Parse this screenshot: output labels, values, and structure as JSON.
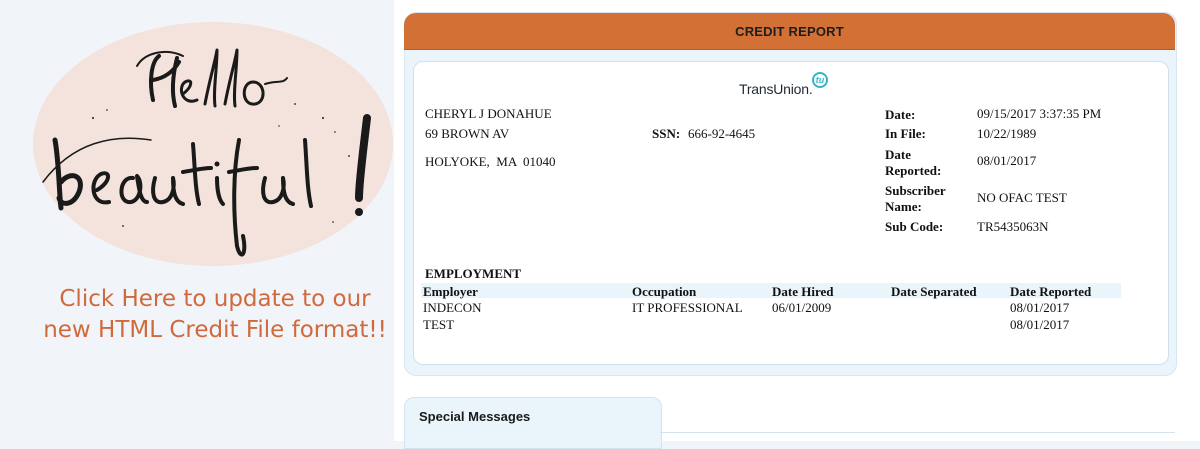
{
  "promo": {
    "link_text": "Click Here to update to our new HTML Credit File format!!"
  },
  "report": {
    "header_title": "CREDIT REPORT",
    "bureau": {
      "logo_text": "TransUnion.",
      "badge": "tu",
      "logo_color": "#33b5c9"
    },
    "consumer": {
      "name": "CHERYL J DONAHUE",
      "address_line1": "69 BROWN AV",
      "city_state_zip": "HOLYOKE,  MA  01040",
      "ssn_label": "SSN:",
      "ssn_value": "666-92-4645"
    },
    "meta": {
      "date_label": "Date:",
      "date_value": "09/15/2017 3:37:35 PM",
      "in_file_label": "In File:",
      "in_file_value": "10/22/1989",
      "date_reported_label_1": "Date",
      "date_reported_label_2": "Reported:",
      "date_reported_value": "08/01/2017",
      "subscriber_label_1": "Subscriber",
      "subscriber_label_2": "Name:",
      "subscriber_value": "NO OFAC TEST",
      "sub_code_label": "Sub Code:",
      "sub_code_value": "TR5435063N"
    },
    "employment": {
      "section_title": "EMPLOYMENT",
      "columns": [
        "Employer",
        "Occupation",
        "Date Hired",
        "Date Separated",
        "Date Reported"
      ],
      "rows": [
        {
          "employer": "INDECON",
          "occupation": "IT PROFESSIONAL",
          "date_hired": "06/01/2009",
          "date_separated": "",
          "date_reported": "08/01/2017"
        },
        {
          "employer": "TEST",
          "occupation": "",
          "date_hired": "",
          "date_separated": "",
          "date_reported": "08/01/2017"
        }
      ]
    }
  },
  "special_messages": {
    "label": "Special Messages"
  },
  "colors": {
    "header_orange": "#d27035",
    "link_orange": "#d06a3c",
    "panel_blue": "#eaf4fb",
    "oval_pink": "#f3e3dc"
  }
}
